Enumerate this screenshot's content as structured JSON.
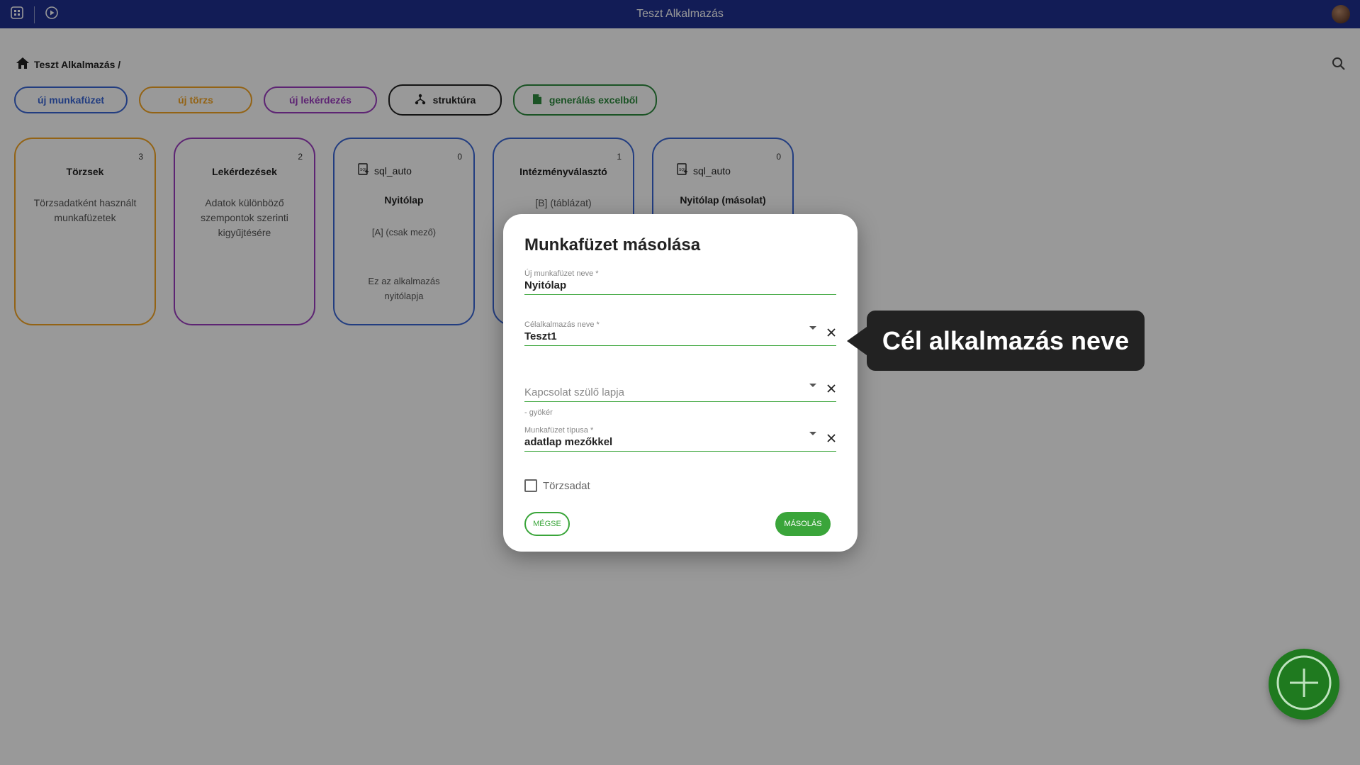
{
  "app": {
    "title": "Teszt Alkalmazás"
  },
  "breadcrumb": {
    "label": "Teszt Alkalmazás /"
  },
  "toolbar": {
    "new_workbook": "új munkafüzet",
    "new_master": "új törzs",
    "new_query": "új lekérdezés",
    "structure": "struktúra",
    "generate_excel": "generálás excelből"
  },
  "cards": [
    {
      "title": "Törzsek",
      "count": "3",
      "description": "Törzsadatként használt munkafüzetek"
    },
    {
      "title": "Lekérdezések",
      "count": "2",
      "description": "Adatok különböző szempontok szerinti kigyűjtésére"
    },
    {
      "tag": "sql_auto",
      "title": "Nyitólap",
      "count": "0",
      "subtitle": "[A] (csak mező)",
      "description": "Ez az alkalmazás nyitólapja"
    },
    {
      "title": "Intézményválasztó",
      "count": "1",
      "subtitle": "[B] (táblázat)"
    },
    {
      "tag": "sql_auto",
      "title": "Nyitólap (másolat)",
      "count": "0"
    }
  ],
  "dialog": {
    "title": "Munkafüzet másolása",
    "new_name_label": "Új munkafüzet neve *",
    "new_name_value": "Nyitólap",
    "target_app_label": "Célalkalmazás neve *",
    "target_app_value": "Teszt1",
    "parent_placeholder": "Kapcsolat szülő lapja",
    "parent_hint": "- gyökér",
    "type_label": "Munkafüzet típusa *",
    "type_value": "adatlap mezőkkel",
    "master_checkbox": "Törzsadat",
    "cancel": "MÉGSE",
    "copy": "MÁSOLÁS"
  },
  "tooltip": {
    "text": "Cél alkalmazás neve"
  },
  "colors": {
    "topbar": "#1e2f8f",
    "accent_green": "#3aa53a",
    "blue": "#3a66d6",
    "orange": "#f5a623",
    "purple": "#9b3cc0"
  }
}
